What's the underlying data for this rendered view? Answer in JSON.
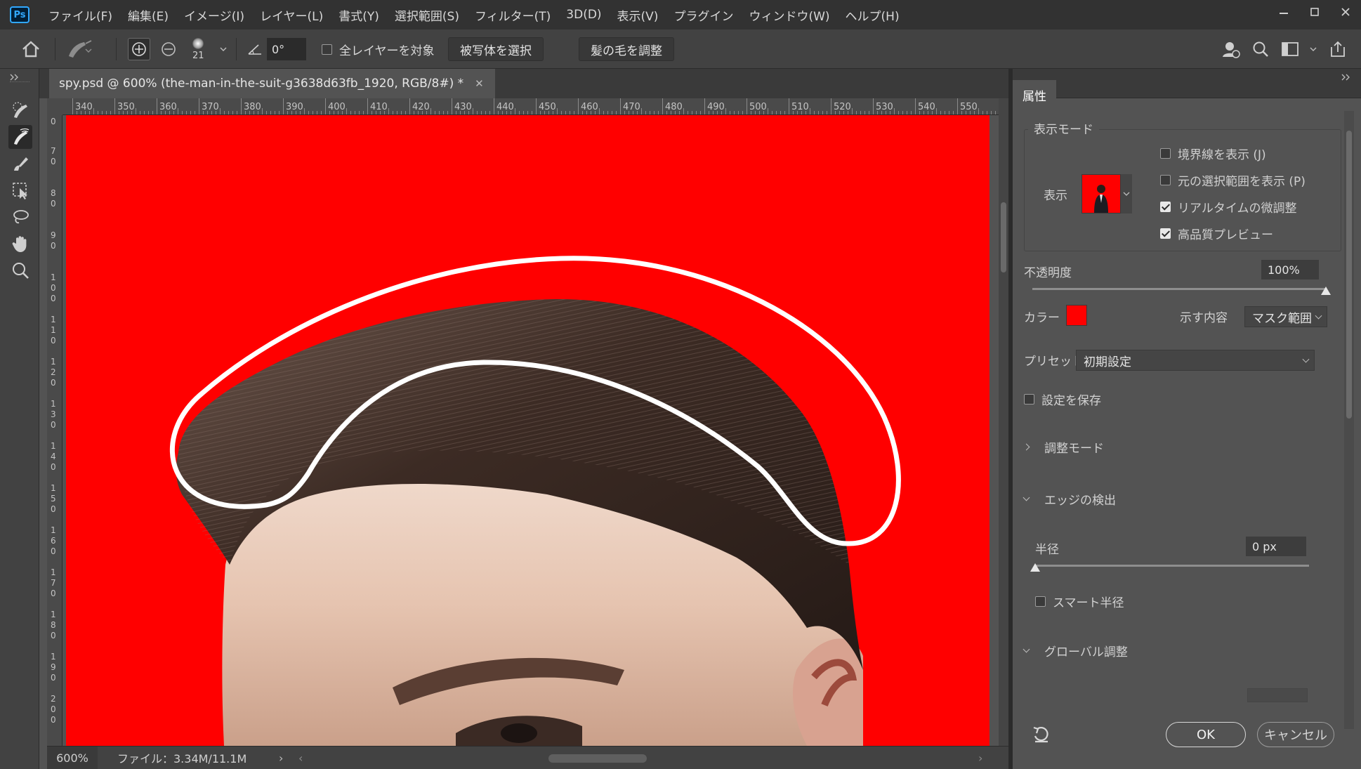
{
  "app": {
    "logo": "Ps"
  },
  "menu": [
    "ファイル(F)",
    "編集(E)",
    "イメージ(I)",
    "レイヤー(L)",
    "書式(Y)",
    "選択範囲(S)",
    "フィルター(T)",
    "3D(D)",
    "表示(V)",
    "プラグイン",
    "ウィンドウ(W)",
    "ヘルプ(H)"
  ],
  "options": {
    "brush_size": "21",
    "angle_value": "0°",
    "sample_all_layers": "全レイヤーを対象",
    "select_subject": "被写体を選択",
    "refine_hair": "髪の毛を調整"
  },
  "document": {
    "tab_title": "spy.psd @ 600% (the-man-in-the-suit-g3638d63fb_1920, RGB/8#) *",
    "zoom": "600%",
    "file_info": "ファイル：3.34M/11.1M",
    "ruler_top": [
      "340",
      "350",
      "360",
      "370",
      "380",
      "390",
      "400",
      "410",
      "420",
      "430",
      "440",
      "450",
      "460",
      "470",
      "480",
      "490",
      "500",
      "510",
      "520",
      "530",
      "540",
      "550"
    ],
    "ruler_left": [
      "0",
      "70",
      "80",
      "90",
      "100",
      "110",
      "120",
      "130",
      "140",
      "150",
      "160",
      "170",
      "180",
      "190",
      "200"
    ],
    "overlay_color": "#ff0000",
    "stroke_color": "#ffffff"
  },
  "properties": {
    "tab": "属性",
    "view_mode": {
      "legend": "表示モード",
      "view_label": "表示",
      "show_edge": {
        "label": "境界線を表示 (J)",
        "checked": false
      },
      "show_original": {
        "label": "元の選択範囲を表示 (P)",
        "checked": false
      },
      "realtime_refine": {
        "label": "リアルタイムの微調整",
        "checked": true
      },
      "high_quality_preview": {
        "label": "高品質プレビュー",
        "checked": true
      }
    },
    "opacity": {
      "label": "不透明度",
      "value": "100%",
      "percent": 100
    },
    "color": {
      "label": "カラー",
      "swatch": "#ff0000"
    },
    "indicates": {
      "label": "示す内容",
      "value": "マスク範囲"
    },
    "preset": {
      "label": "プリセット",
      "value": "初期設定"
    },
    "remember_settings": {
      "label": "設定を保存",
      "checked": false
    },
    "refine_mode": {
      "label": "調整モード",
      "expanded": false
    },
    "edge_detection": {
      "label": "エッジの検出",
      "expanded": true
    },
    "radius": {
      "label": "半径",
      "value": "0 px",
      "percent": 0
    },
    "smart_radius": {
      "label": "スマート半径",
      "checked": false
    },
    "global_refinements": {
      "label": "グローバル調整",
      "expanded": true
    },
    "ok": "OK",
    "cancel": "キャンセル"
  }
}
